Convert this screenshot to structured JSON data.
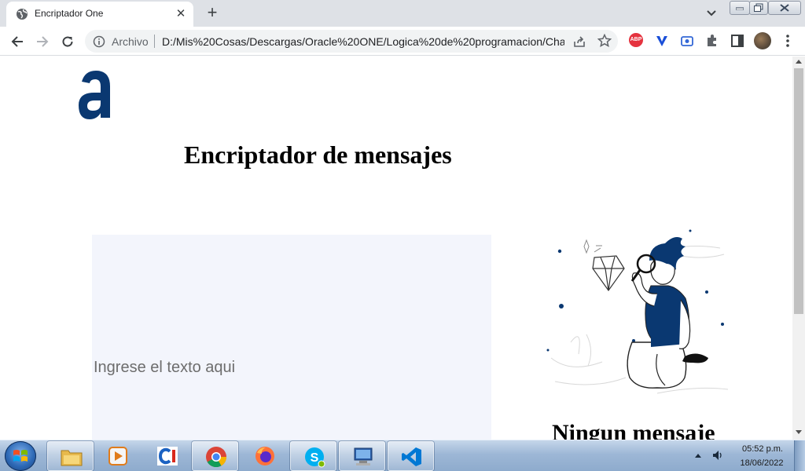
{
  "browser": {
    "tab": {
      "title": "Encriptador One",
      "favicon": "globe-icon"
    },
    "omnibox": {
      "scheme_label": "Archivo",
      "url": "D:/Mis%20Cosas/Descargas/Oracle%20ONE/Logica%20de%20programacion/Cha..."
    },
    "extensions": {
      "abp_badge": "ABP"
    }
  },
  "page": {
    "logo": "alura-logo",
    "heading": "Encriptador de mensajes",
    "input_placeholder": "Ingrese el texto aqui",
    "output_title": "Ningun mensaje",
    "illustration": "person-with-magnifying-glass-illustration",
    "colors": {
      "accent": "#0a3871",
      "input_bg": "#f3f5fc"
    }
  },
  "taskbar": {
    "apps": [
      "windows-explorer-icon",
      "media-player-icon",
      "ccleaner-icon",
      "chrome-icon",
      "firefox-icon",
      "skype-icon",
      "remote-desktop-icon",
      "vscode-icon"
    ],
    "clock": {
      "time": "05:52 p.m.",
      "date": "18/06/2022"
    }
  }
}
